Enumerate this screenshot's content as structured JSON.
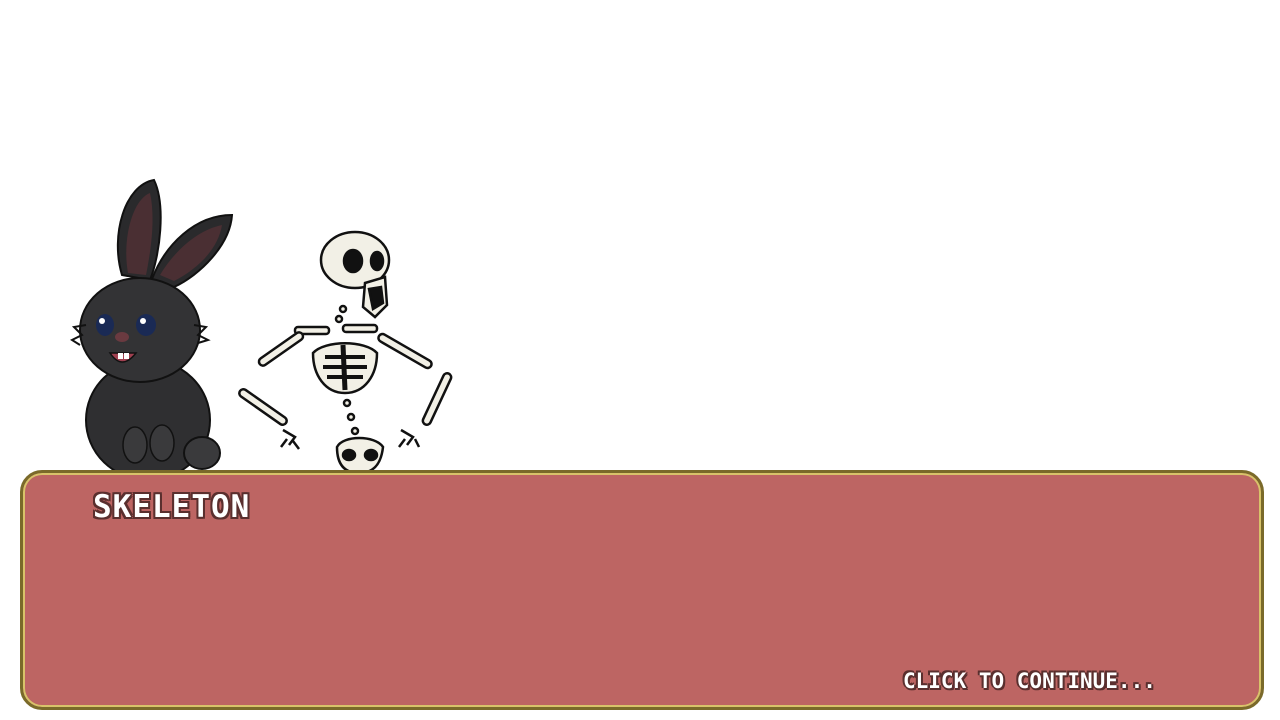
{
  "scene": {
    "background_color": "#ffffff",
    "characters": [
      {
        "name": "bunny",
        "color": "#2e2e30"
      },
      {
        "name": "skeleton",
        "color": "#f2f0e6"
      }
    ]
  },
  "dialog": {
    "speaker": "SKELETON",
    "text": "",
    "continue_label": "CLICK TO CONTINUE...",
    "box_color": "#bd6563",
    "border_color": "#7a6a2a"
  }
}
